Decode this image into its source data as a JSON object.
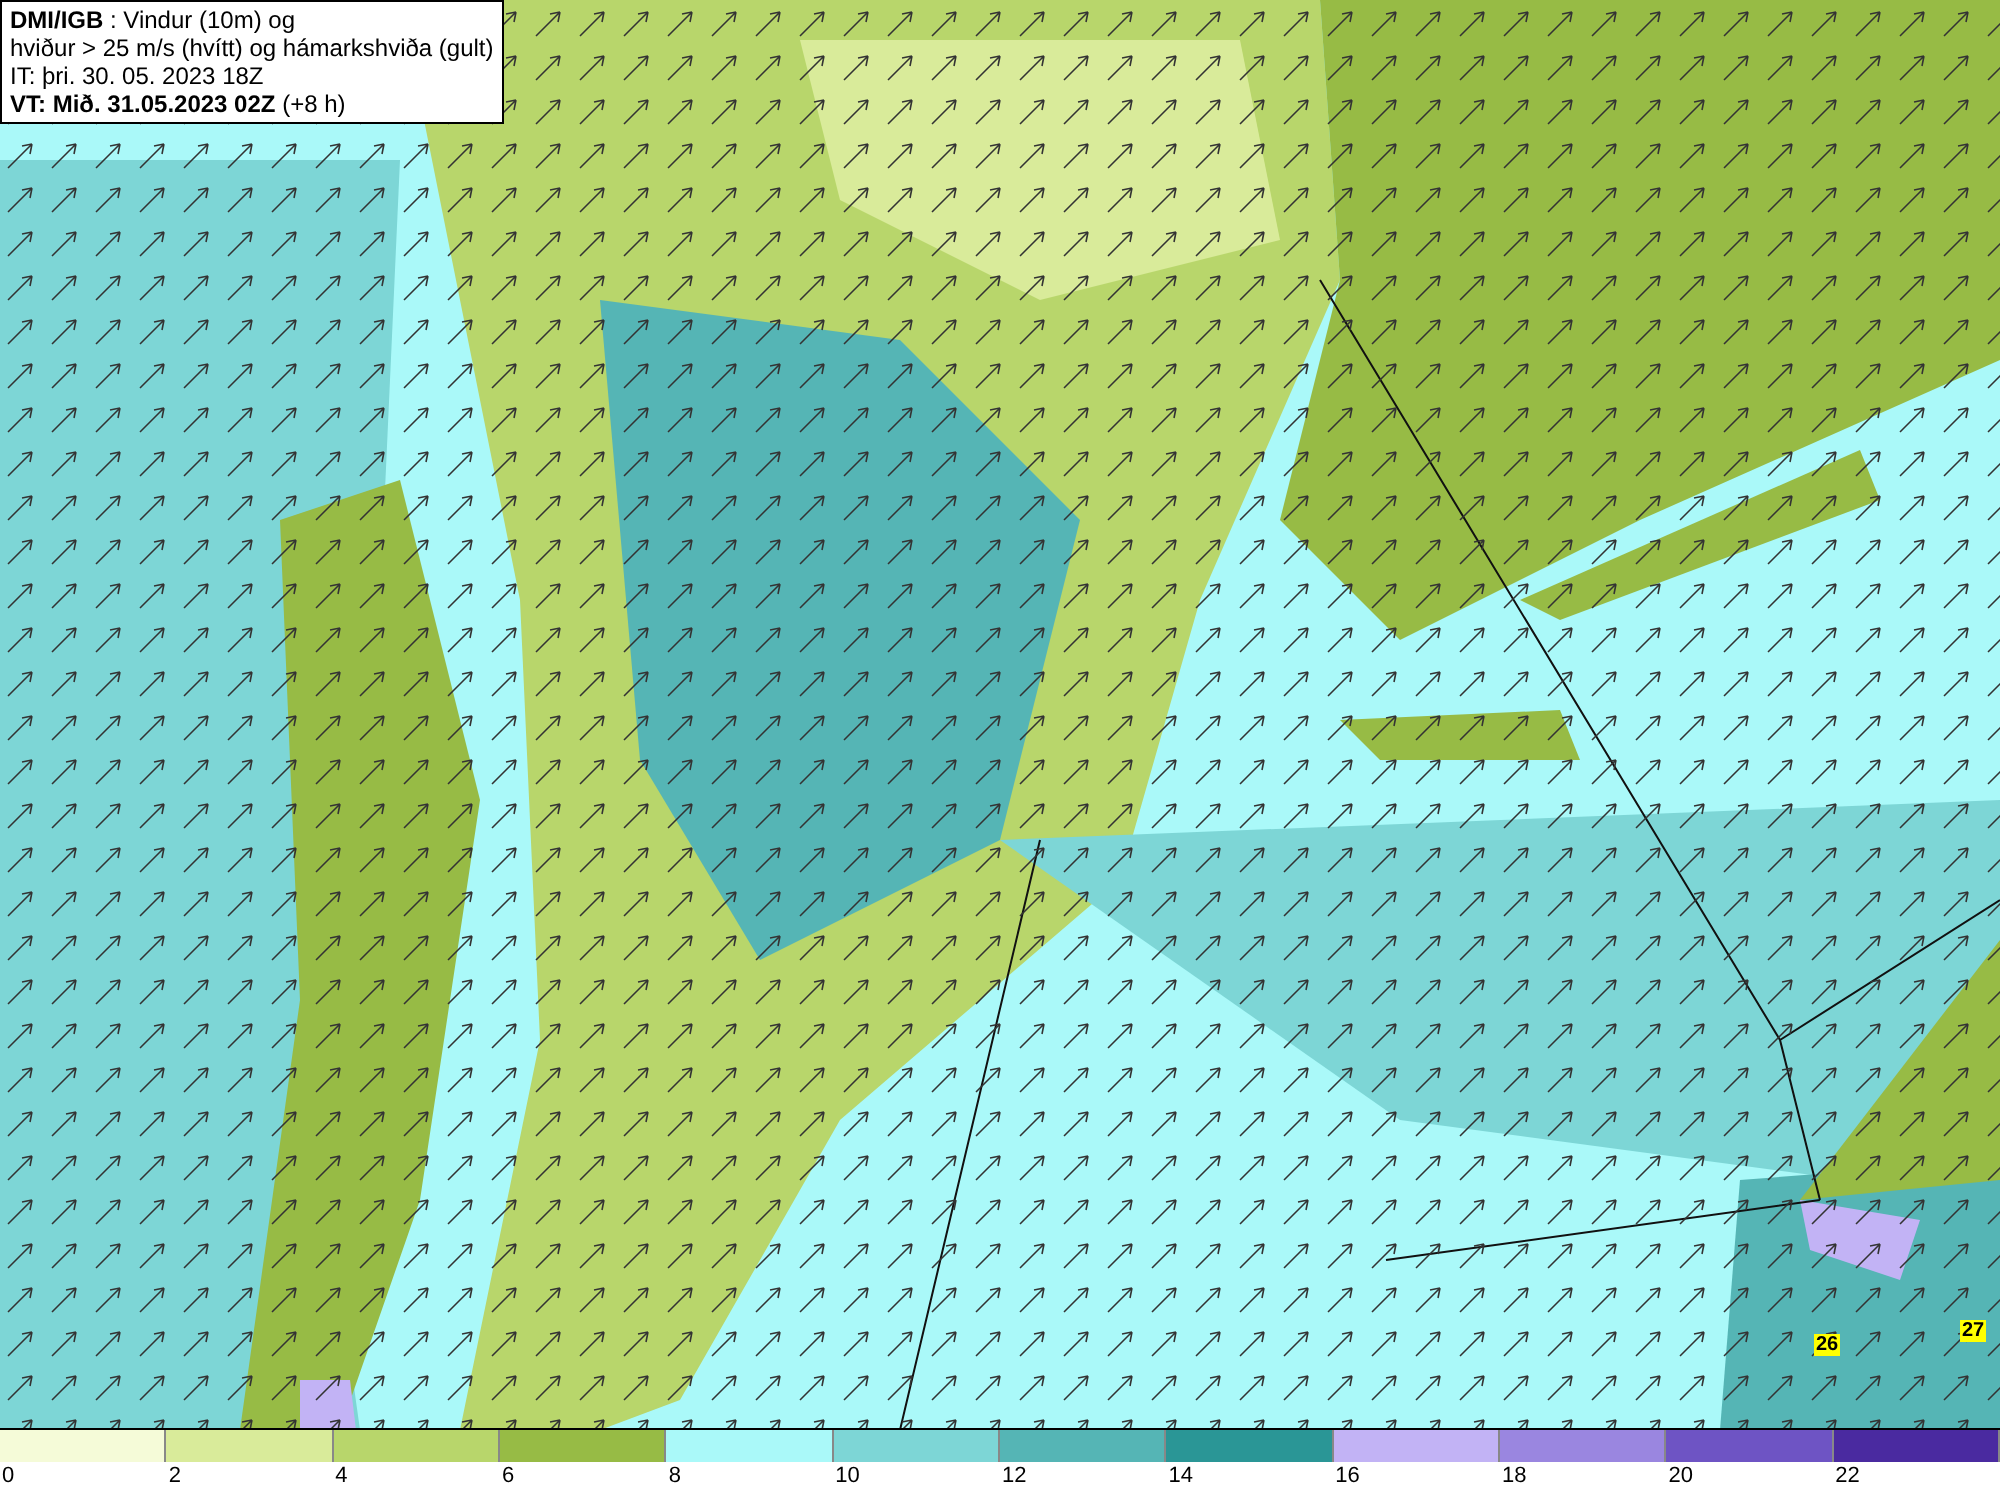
{
  "title_box": {
    "lines": [
      "**DMI/IGB** : Vindur (10m) og",
      "hviður > 25 m/s (hvítt) og hámarkshviða (gult)",
      "IT: þri. 30. 05. 2023 18Z",
      "**VT: Mið. 31.05.2023 02Z** (+8 h)"
    ]
  },
  "gust_labels": [
    "26",
    "27"
  ],
  "legend": {
    "segments": [
      {
        "color": "#f5fbd8",
        "label": "0"
      },
      {
        "color": "#d9eb9a",
        "label": "2"
      },
      {
        "color": "#b8d66b",
        "label": "4"
      },
      {
        "color": "#97bb45",
        "label": "6"
      },
      {
        "color": "#aaf9f9",
        "label": "8"
      },
      {
        "color": "#7dd6d6",
        "label": "10"
      },
      {
        "color": "#55b5b5",
        "label": "12"
      },
      {
        "color": "#2a9696",
        "label": "14"
      },
      {
        "color": "#c2b3f5",
        "label": "16"
      },
      {
        "color": "#9a86e0",
        "label": "18"
      },
      {
        "color": "#6e54c4",
        "label": "20"
      },
      {
        "color": "#4a2aa0",
        "label": "22"
      }
    ]
  }
}
